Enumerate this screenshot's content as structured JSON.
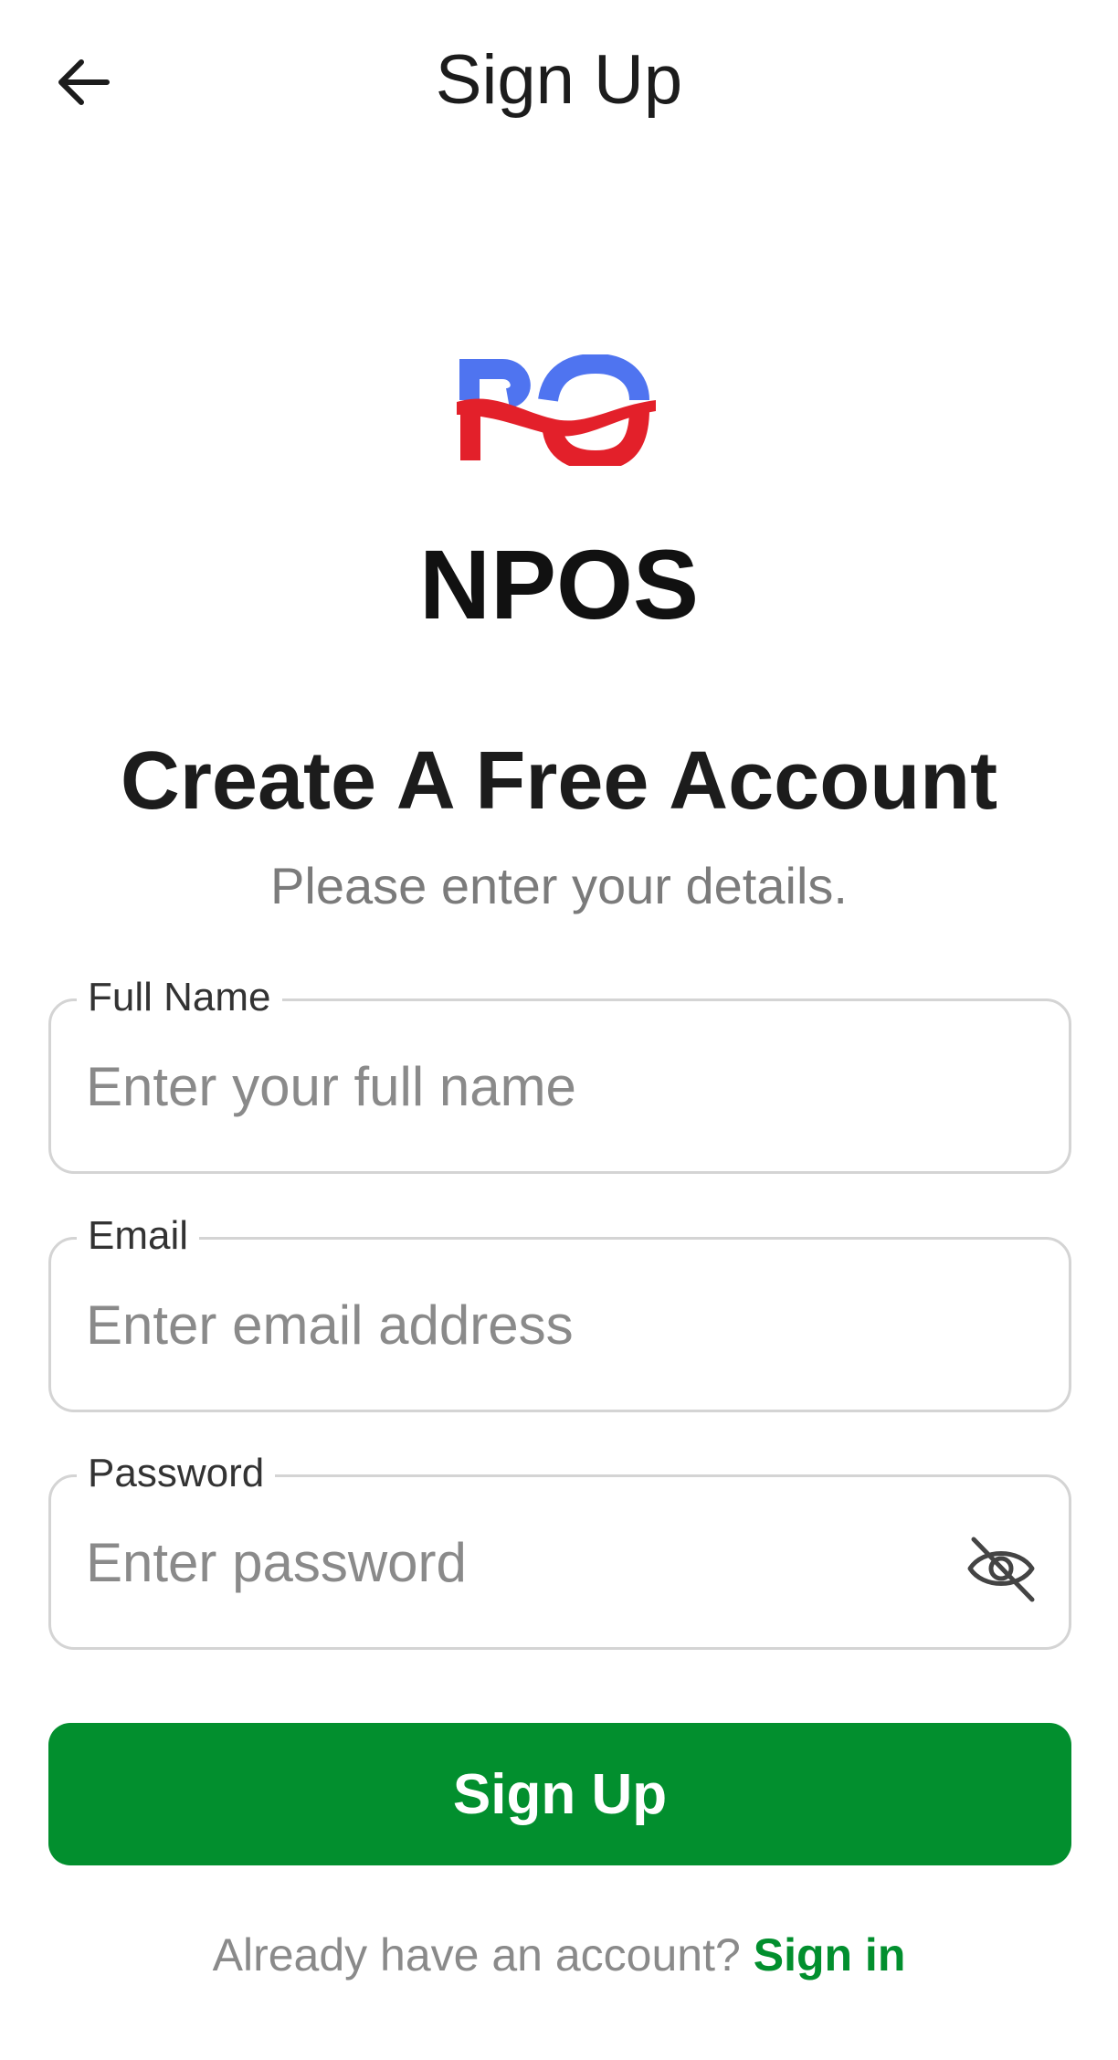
{
  "header": {
    "title": "Sign Up",
    "back_icon": "arrow-left-icon"
  },
  "brand": {
    "logo_text": "PO",
    "logo_colors": {
      "top": "#4f74f0",
      "bottom": "#e3202a"
    },
    "app_name": "NPOS"
  },
  "intro": {
    "heading": "Create A Free Account",
    "subheading": "Please enter your details."
  },
  "form": {
    "full_name": {
      "label": "Full Name",
      "placeholder": "Enter your full name",
      "value": ""
    },
    "email": {
      "label": "Email",
      "placeholder": "Enter email address",
      "value": ""
    },
    "password": {
      "label": "Password",
      "placeholder": "Enter password",
      "value": "",
      "toggle_icon": "eye-off-icon"
    },
    "submit_label": "Sign Up"
  },
  "footer": {
    "prompt": "Already have an account?",
    "link_label": "Sign in"
  },
  "colors": {
    "primary": "#028f2e",
    "field_border": "#d4d4d4",
    "muted_text": "#7b7b7b"
  }
}
